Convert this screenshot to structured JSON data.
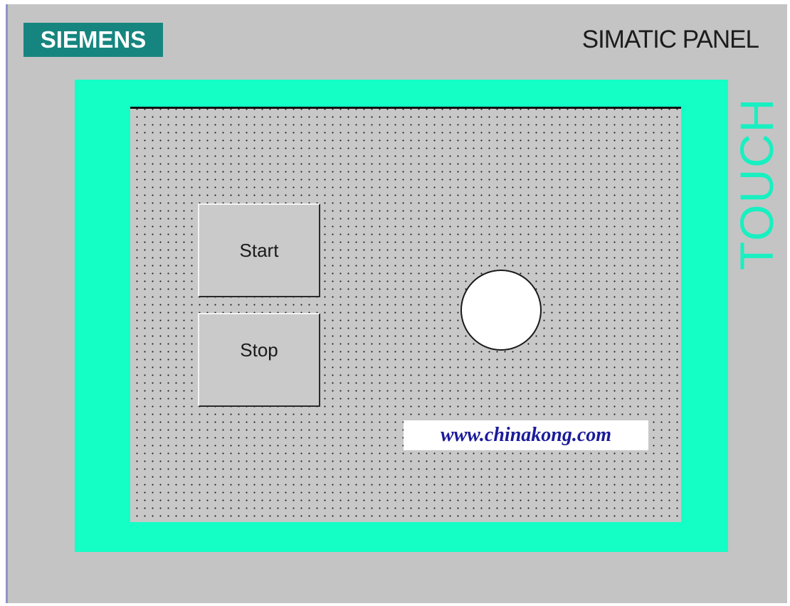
{
  "header": {
    "brand": "SIEMENS",
    "product": "SIMATIC PANEL"
  },
  "side_label": "TOUCH",
  "screen": {
    "buttons": [
      {
        "label": "Start"
      },
      {
        "label": "Stop"
      }
    ],
    "indicator": {
      "state": "off",
      "color": "#ffffff"
    },
    "watermark": "www.chinakong.com"
  },
  "colors": {
    "bezel": "#13ffc6",
    "brand_bg": "#16857f",
    "panel_bg": "#c4c4c4",
    "screen_bg": "#c8c8c8",
    "watermark_text": "#1b1b9a"
  }
}
